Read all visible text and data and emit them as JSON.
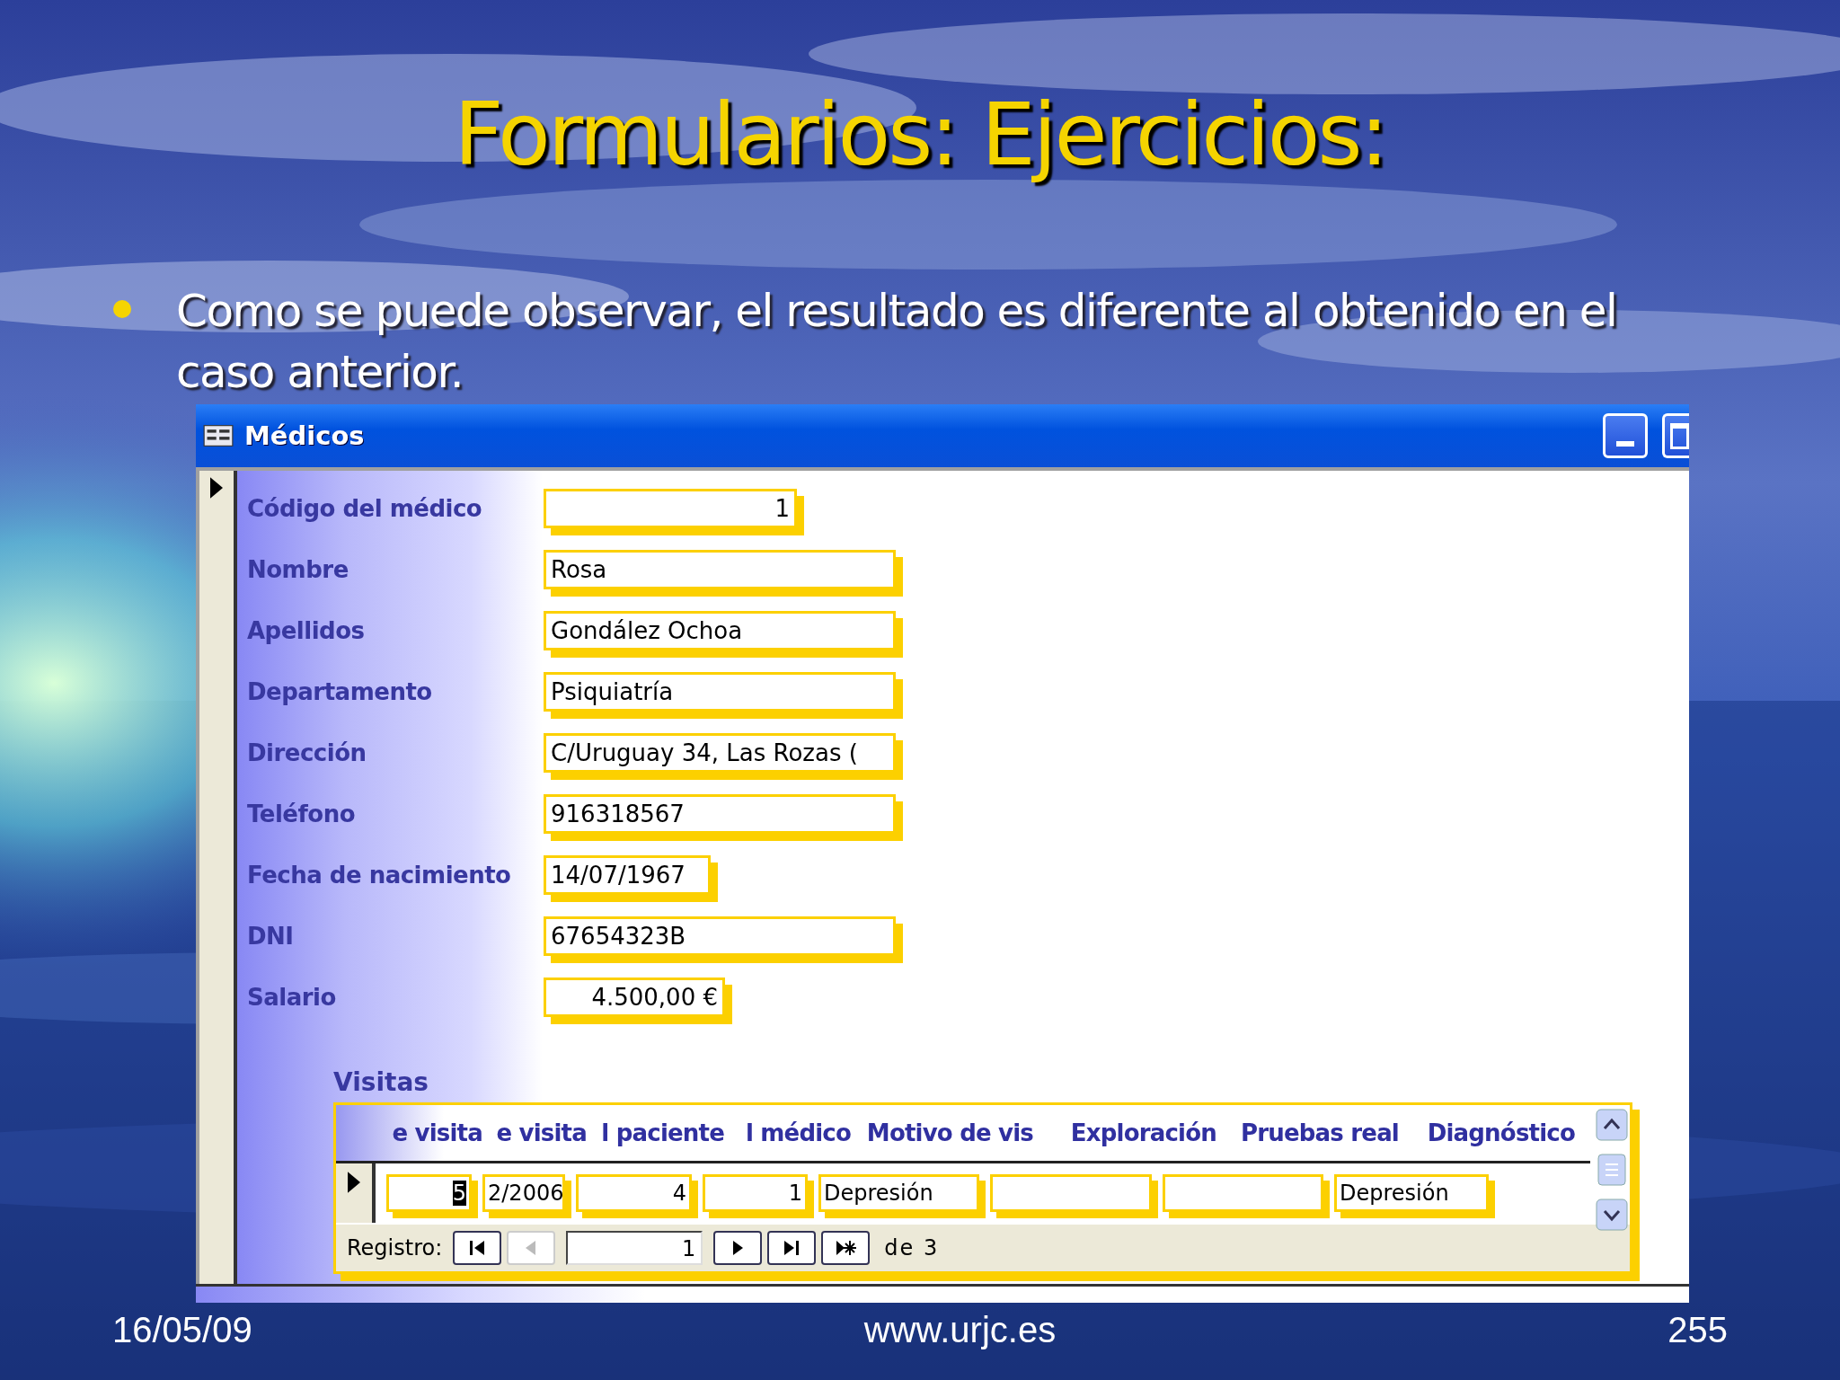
{
  "slide": {
    "title": "Formularios: Ejercicios:",
    "bullets": [
      {
        "text": "Como se puede observar, el resultado es diferente al obtenido en el caso anterior."
      }
    ]
  },
  "window": {
    "title": "Médicos",
    "fields": [
      {
        "label": "Código del médico",
        "value": "1",
        "kind": "number"
      },
      {
        "label": "Nombre",
        "value": "Rosa",
        "kind": "text"
      },
      {
        "label": "Apellidos",
        "value": "Gondález Ochoa",
        "kind": "text"
      },
      {
        "label": "Departamento",
        "value": "Psiquiatría",
        "kind": "text"
      },
      {
        "label": "Dirección",
        "value": "C/Uruguay 34, Las Rozas (",
        "kind": "text"
      },
      {
        "label": "Teléfono",
        "value": "916318567",
        "kind": "text"
      },
      {
        "label": "Fecha de nacimiento",
        "value": "14/07/1967",
        "kind": "date"
      },
      {
        "label": "DNI",
        "value": "67654323B",
        "kind": "text"
      },
      {
        "label": "Salario",
        "value": "4.500,00 €",
        "kind": "currency"
      }
    ],
    "subform": {
      "label": "Visitas",
      "columns": [
        "e visita",
        "e visita",
        "l paciente",
        "l médico",
        "Motivo de vis",
        "Exploración",
        "Pruebas real",
        "Diagnóstico"
      ],
      "cells": [
        {
          "value": "5",
          "kind": "number",
          "focused": true
        },
        {
          "value": "2/2006",
          "kind": "text",
          "focused": false
        },
        {
          "value": "4",
          "kind": "number",
          "focused": false
        },
        {
          "value": "1",
          "kind": "number",
          "focused": false
        },
        {
          "value": "Depresión",
          "kind": "text",
          "focused": false
        },
        {
          "kind": "text",
          "focused": false
        },
        {
          "kind": "text",
          "focused": false
        },
        {
          "value": "Depresión",
          "kind": "text",
          "focused": false
        }
      ],
      "navigation": {
        "label": "Registro:",
        "buttons_before": [
          {
            "kind": "first",
            "disabled": false
          },
          {
            "kind": "prev",
            "disabled": true
          }
        ],
        "current": "1",
        "buttons_after": [
          {
            "kind": "next",
            "disabled": false
          },
          {
            "kind": "last",
            "disabled": false
          },
          {
            "kind": "new",
            "disabled": false
          }
        ],
        "count": "de 3"
      }
    }
  },
  "footer": {
    "date": "16/05/09",
    "url": "www.urjc.es",
    "page": "255"
  }
}
